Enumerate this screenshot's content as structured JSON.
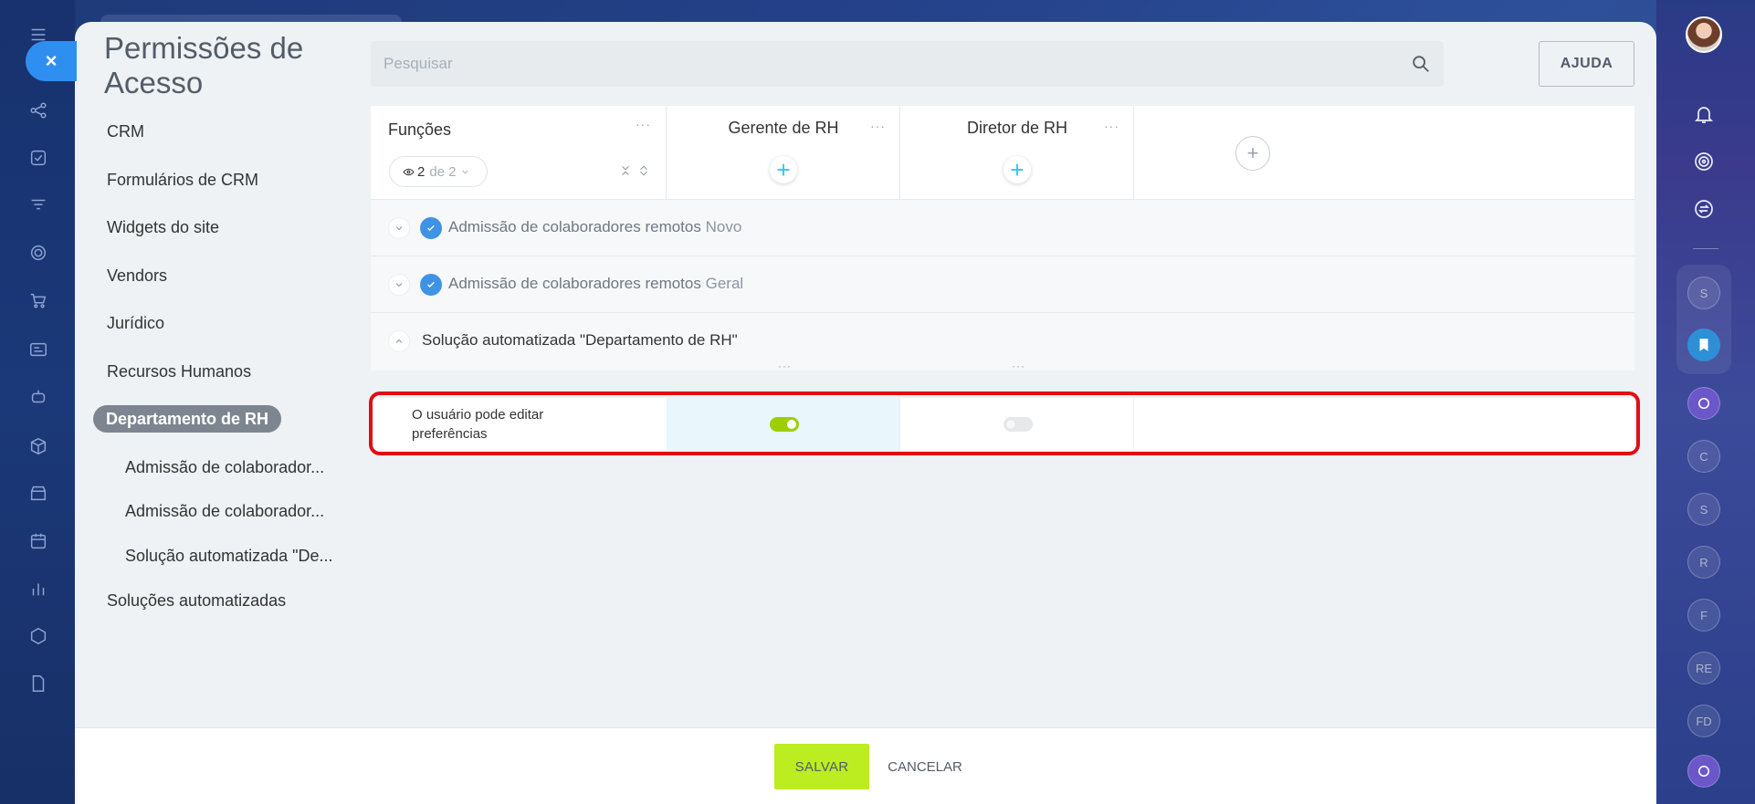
{
  "page": {
    "title": "Permissões de Acesso"
  },
  "search": {
    "placeholder": "Pesquisar"
  },
  "help_label": "AJUDA",
  "nav": {
    "items": [
      {
        "label": "CRM"
      },
      {
        "label": "Formulários de CRM"
      },
      {
        "label": "Widgets do site"
      },
      {
        "label": "Vendors"
      },
      {
        "label": "Jurídico"
      },
      {
        "label": "Recursos Humanos"
      },
      {
        "label": "Departamento de RH"
      },
      {
        "label": "Admissão de colaborador..."
      },
      {
        "label": "Admissão de colaborador..."
      },
      {
        "label": "Solução automatizada \"De..."
      },
      {
        "label": "Soluções automatizadas"
      }
    ],
    "active_index": 6
  },
  "grid": {
    "roles_header": "Funções",
    "counter": {
      "current": "2",
      "of_label": "de 2"
    },
    "roles": [
      {
        "name": "Gerente de RH"
      },
      {
        "name": "Diretor de RH"
      }
    ],
    "sections": [
      {
        "title": "Admissão de colaboradores remotos",
        "subtitle": "Novo",
        "expanded": false
      },
      {
        "title": "Admissão de colaboradores remotos",
        "subtitle": "Geral",
        "expanded": false
      },
      {
        "title": "Solução automatizada \"Departamento de RH\"",
        "subtitle": "",
        "expanded": true
      }
    ],
    "permission": {
      "label": "O usuário pode editar preferências",
      "values": [
        true,
        false
      ]
    }
  },
  "footer": {
    "save_label": "SALVAR",
    "cancel_label": "CANCELAR"
  },
  "right_rail": {
    "bubbles": [
      "S",
      "C",
      "S",
      "R",
      "F",
      "RE",
      "FD"
    ]
  },
  "colors": {
    "accent_green": "#bbed21",
    "toggle_on": "#9dcf00",
    "highlight": "#e10d16",
    "plus_blue": "#2fc6f6"
  }
}
